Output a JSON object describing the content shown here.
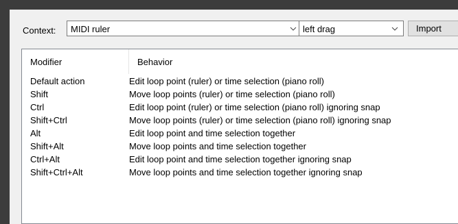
{
  "context_label": "Context:",
  "context_value": "MIDI ruler",
  "action_value": "left drag",
  "import_label": "Import",
  "columns": {
    "modifier": "Modifier",
    "behavior": "Behavior"
  },
  "rows": [
    {
      "modifier": "Default action",
      "behavior": "Edit loop point (ruler) or time selection (piano roll)"
    },
    {
      "modifier": "Shift",
      "behavior": "Move loop points (ruler) or time selection (piano roll)"
    },
    {
      "modifier": "Ctrl",
      "behavior": "Edit loop point (ruler) or time selection (piano roll) ignoring snap"
    },
    {
      "modifier": "Shift+Ctrl",
      "behavior": "Move loop points (ruler) or time selection (piano roll) ignoring snap"
    },
    {
      "modifier": "Alt",
      "behavior": "Edit loop point and time selection together"
    },
    {
      "modifier": "Shift+Alt",
      "behavior": "Move loop points and time selection together"
    },
    {
      "modifier": "Ctrl+Alt",
      "behavior": "Edit loop point and time selection together ignoring snap"
    },
    {
      "modifier": "Shift+Ctrl+Alt",
      "behavior": "Move loop points and time selection together ignoring snap"
    }
  ]
}
